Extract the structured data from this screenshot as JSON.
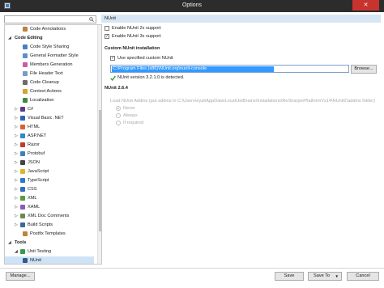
{
  "window": {
    "title": "Options",
    "close_glyph": "✕"
  },
  "search": {
    "placeholder": "",
    "value": ""
  },
  "tree": [
    {
      "label": "Code Annotations",
      "icon": "annotations-icon",
      "color": "#b5853a",
      "indent": 2
    },
    {
      "label": "Code Editing",
      "expander": "◢",
      "indent": 0,
      "bold": true
    },
    {
      "label": "Code Style Sharing",
      "icon": "style-sharing-icon",
      "color": "#4a7fbf",
      "indent": 2
    },
    {
      "label": "General Formatter Style",
      "icon": "formatter-icon",
      "color": "#5f8fc7",
      "indent": 2
    },
    {
      "label": "Members Generation",
      "icon": "members-icon",
      "color": "#c75fa2",
      "indent": 2
    },
    {
      "label": "File Header Text",
      "icon": "file-header-icon",
      "color": "#7a9bc2",
      "indent": 2
    },
    {
      "label": "Code Cleanup",
      "icon": "cleanup-icon",
      "color": "#6c6c6c",
      "indent": 2
    },
    {
      "label": "Context Actions",
      "icon": "context-actions-icon",
      "color": "#d4a52c",
      "indent": 2
    },
    {
      "label": "Localization",
      "icon": "localization-icon",
      "color": "#3b8a3b",
      "indent": 2
    },
    {
      "label": "C#",
      "expander": "▷",
      "icon": "csharp-icon",
      "color": "#5d3b8a",
      "indent": 1
    },
    {
      "label": "Visual Basic .NET",
      "expander": "▷",
      "icon": "vb-icon",
      "color": "#2f63b8",
      "indent": 1
    },
    {
      "label": "HTML",
      "expander": "▷",
      "icon": "html-icon",
      "color": "#d9602e",
      "indent": 1
    },
    {
      "label": "ASP.NET",
      "expander": "▷",
      "icon": "aspnet-icon",
      "color": "#2c8ac4",
      "indent": 1
    },
    {
      "label": "Razor",
      "expander": "▷",
      "icon": "razor-icon",
      "color": "#c0392b",
      "indent": 1
    },
    {
      "label": "Protobuf",
      "expander": "▷",
      "icon": "protobuf-icon",
      "color": "#3f7fbf",
      "indent": 1
    },
    {
      "label": "JSON",
      "expander": "▷",
      "icon": "json-icon",
      "color": "#444444",
      "indent": 1
    },
    {
      "label": "JavaScript",
      "expander": "▷",
      "icon": "javascript-icon",
      "color": "#e0b52c",
      "indent": 1
    },
    {
      "label": "TypeScript",
      "expander": "▷",
      "icon": "typescript-icon",
      "color": "#2d79c7",
      "indent": 1
    },
    {
      "label": "CSS",
      "expander": "▷",
      "icon": "css-icon",
      "color": "#2f6fbf",
      "indent": 1
    },
    {
      "label": "XML",
      "expander": "▷",
      "icon": "xml-icon",
      "color": "#5a9a3a",
      "indent": 1
    },
    {
      "label": "XAML",
      "expander": "▷",
      "icon": "xaml-icon",
      "color": "#8a5ab8",
      "indent": 1
    },
    {
      "label": "XML Doc Comments",
      "expander": "▷",
      "icon": "xml-doc-icon",
      "color": "#6a8a4a",
      "indent": 1
    },
    {
      "label": "Build Scripts",
      "expander": "▷",
      "icon": "build-scripts-icon",
      "color": "#3b6a9a",
      "indent": 1
    },
    {
      "label": "Postfix Templates",
      "icon": "postfix-icon",
      "color": "#b8863a",
      "indent": 2
    },
    {
      "label": "Tools",
      "expander": "◢",
      "indent": 0,
      "bold": true
    },
    {
      "label": "Unit Testing",
      "expander": "◢",
      "icon": "unit-testing-icon",
      "color": "#3a9a4a",
      "indent": 1
    },
    {
      "label": "NUnit",
      "icon": "nunit-icon",
      "color": "#2f5a8a",
      "indent": 2,
      "selected": true
    }
  ],
  "panel": {
    "header": "NUnit",
    "enable_2x": "Enable NUnit 2x support",
    "enable_3x": "Enable NUnit 3x support",
    "custom_section": "Custom NUnit installation",
    "use_specified": "Use specified custom NUnit",
    "path_value": "C:\\Program Files (x86)\\NUnit.org\\nunit-console",
    "browse_label": "Browse...",
    "detected": "NUnit version 3.2.1.0 is detected.",
    "version_section": "NUnit 2.6.4",
    "load_addins": "Load NUnit Addins (put addins in C:\\Users\\eyal\\AppData\\Local\\JetBrains\\Installations\\ReSharperPlatformVs14\\NUnit2\\addins folder)",
    "radio_never": "Never",
    "radio_always": "Always",
    "radio_if_required": "If required"
  },
  "footer": {
    "manage": "Manage...",
    "save": "Save",
    "save_to": "Save To",
    "save_to_arrow": "▼",
    "cancel": "Cancel"
  },
  "colors": {
    "titlebar": "#2c2c2c",
    "close_button": "#c7342e",
    "header_bar": "#d6e6f4",
    "selection": "#3399ff",
    "check_green": "#3a9a3a"
  }
}
